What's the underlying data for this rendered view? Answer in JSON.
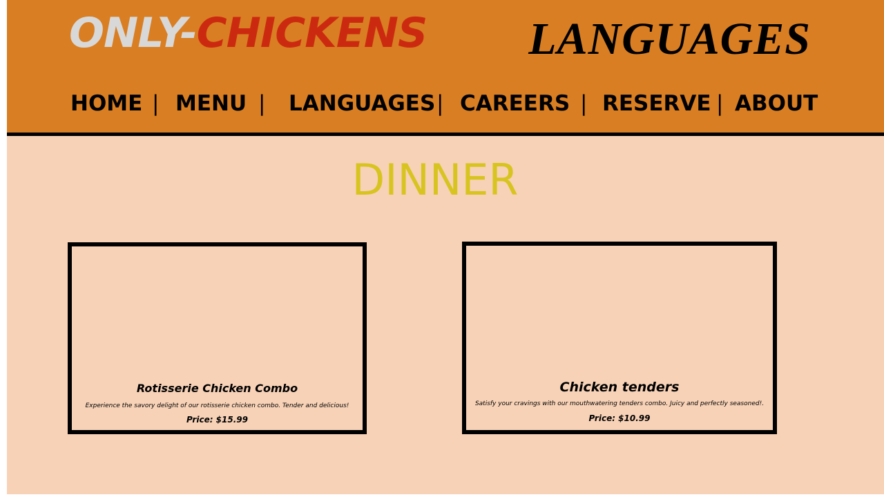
{
  "header": {
    "logo_part1": "ONLY-",
    "logo_part2": "CHICKENS",
    "page_heading": "LANGUAGES"
  },
  "nav": {
    "items": [
      {
        "label": "HOME"
      },
      {
        "label": "MENU"
      },
      {
        "label": "LANGUAGES"
      },
      {
        "label": "CAREERS"
      },
      {
        "label": "RESERVE"
      },
      {
        "label": "ABOUT"
      }
    ],
    "separator": "|"
  },
  "section": {
    "title": "DINNER"
  },
  "menu_items": [
    {
      "name": "Rotisserie Chicken Combo",
      "description": "Experience the savory delight of our rotisserie chicken combo. Tender and delicious!",
      "price": "Price: $15.99"
    },
    {
      "name": "Chicken tenders",
      "description": "Satisfy your cravings with our mouthwatering tenders combo. Juicy and perfectly seasoned!.",
      "price": "Price: $10.99"
    }
  ],
  "colors": {
    "header_bg": "#d97e22",
    "page_bg": "#f7d2b7",
    "logo_grey": "#d8d8d8",
    "logo_red": "#cc2a10",
    "section_title": "#d8c420"
  }
}
